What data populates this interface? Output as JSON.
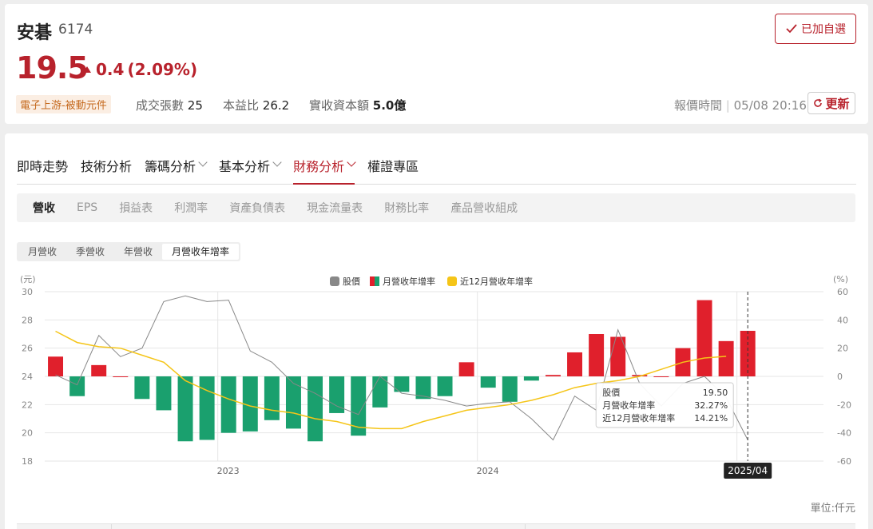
{
  "stock": {
    "name": "安碁",
    "code": "6174",
    "price": "19.5",
    "change": "0.4",
    "change_pct": "(2.09%)",
    "industry": "電子上游-被動元件",
    "volume_label": "成交張數",
    "volume": "25",
    "pe_label": "本益比",
    "pe": "26.2",
    "capital_label": "實收資本額",
    "capital": "5.0億",
    "quote_time_label": "報價時間",
    "quote_time": "05/08 20:16",
    "watch_label": "已加自選",
    "refresh_label": "更新"
  },
  "tabs": [
    {
      "label": "即時走勢"
    },
    {
      "label": "技術分析"
    },
    {
      "label": "籌碼分析"
    },
    {
      "label": "基本分析"
    },
    {
      "label": "財務分析"
    },
    {
      "label": "權證專區"
    }
  ],
  "sub_tabs": [
    {
      "label": "營收"
    },
    {
      "label": "EPS"
    },
    {
      "label": "損益表"
    },
    {
      "label": "利潤率"
    },
    {
      "label": "資產負債表"
    },
    {
      "label": "現金流量表"
    },
    {
      "label": "財務比率"
    },
    {
      "label": "產品營收組成"
    }
  ],
  "segments": [
    {
      "label": "月營收"
    },
    {
      "label": "季營收"
    },
    {
      "label": "年營收"
    },
    {
      "label": "月營收年增率"
    }
  ],
  "unit_label": "單位:仟元",
  "colors": {
    "accent": "#b8222c",
    "bar_positive": "#e0202c",
    "bar_negative": "#1aa06e",
    "price_line": "#888888",
    "yoy12_line": "#f5c518"
  },
  "chart_data": {
    "type": "bar",
    "left_axis_label": "(元)",
    "right_axis_label": "(%)",
    "left_ylim": [
      18,
      30
    ],
    "left_ticks": [
      30,
      28,
      26,
      24,
      22,
      20,
      18
    ],
    "right_ylim": [
      -60,
      60
    ],
    "right_ticks": [
      60,
      40,
      20,
      0,
      -20,
      -40,
      -60
    ],
    "x_ticks": [
      "2023",
      "2024",
      "2025"
    ],
    "legend": [
      "股價",
      "月營收年增率",
      "近12月營收年增率"
    ],
    "months": [
      "2022/05",
      "2022/06",
      "2022/07",
      "2022/08",
      "2022/09",
      "2022/10",
      "2022/11",
      "2022/12",
      "2023/01",
      "2023/02",
      "2023/03",
      "2023/04",
      "2023/05",
      "2023/06",
      "2023/07",
      "2023/08",
      "2023/09",
      "2023/10",
      "2023/11",
      "2023/12",
      "2024/01",
      "2024/02",
      "2024/03",
      "2024/04",
      "2024/05",
      "2024/06",
      "2024/07",
      "2024/08",
      "2024/09",
      "2024/10",
      "2024/11",
      "2024/12",
      "2025/01",
      "2025/02",
      "2025/03",
      "2025/04"
    ],
    "series": [
      {
        "name": "月營收年增率",
        "values": [
          14,
          -14,
          8,
          0,
          -16,
          -24,
          -46,
          -45,
          -40,
          -39,
          -31,
          -37,
          -46,
          -26,
          -42,
          -22,
          -11,
          -16,
          -14,
          10,
          -8,
          -18,
          -3,
          1,
          17,
          30,
          28,
          1,
          0,
          20,
          54,
          25,
          32.27,
          null,
          null,
          null
        ]
      },
      {
        "name": "股價",
        "values": [
          24.1,
          23.4,
          26.9,
          25.4,
          26.0,
          29.3,
          29.7,
          29.3,
          29.4,
          25.8,
          25.0,
          23.5,
          22.8,
          21.9,
          21.3,
          24.0,
          22.8,
          22.6,
          22.3,
          21.9,
          22.1,
          22.2,
          21.0,
          19.5,
          22.6,
          21.6,
          27.3,
          23.5,
          21.9,
          23.5,
          24.0,
          22.5,
          19.5,
          null,
          null,
          null
        ]
      },
      {
        "name": "近12月營收年增率",
        "values": [
          32,
          24,
          21,
          20,
          15,
          10,
          -3,
          -10,
          -16,
          -21,
          -24,
          -26,
          -30,
          -32,
          -36,
          -37,
          -37,
          -32,
          -28,
          -24,
          -22,
          -20,
          -17,
          -13,
          -8,
          -5,
          -3,
          0,
          5,
          10,
          13,
          14.21,
          null,
          null,
          null,
          null
        ]
      }
    ],
    "tooltip": {
      "date": "2025/04",
      "rows": [
        {
          "label": "股價",
          "value": "19.50"
        },
        {
          "label": "月營收年增率",
          "value": "32.27%"
        },
        {
          "label": "近12月營收年增率",
          "value": "14.21%"
        }
      ]
    }
  }
}
